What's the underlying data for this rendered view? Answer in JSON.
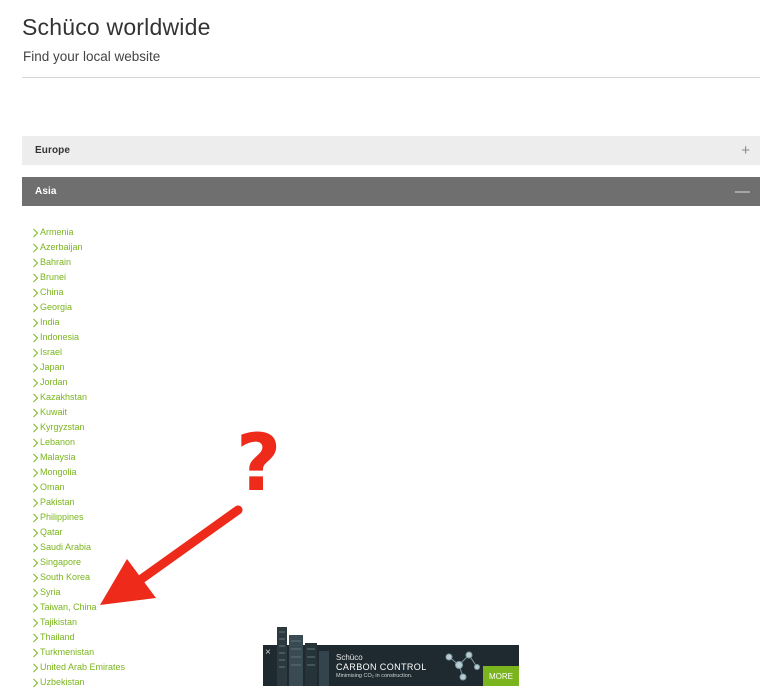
{
  "header": {
    "title": "Schüco worldwide",
    "subtitle": "Find your local website"
  },
  "accordion": {
    "europe": {
      "label": "Europe",
      "toggle": "+"
    },
    "asia": {
      "label": "Asia",
      "toggle": "—"
    }
  },
  "countries": [
    "Armenia",
    "Azerbaijan",
    "Bahrain",
    "Brunei",
    "China",
    "Georgia",
    "India",
    "Indonesia",
    "Israel",
    "Japan",
    "Jordan",
    "Kazakhstan",
    "Kuwait",
    "Kyrgyzstan",
    "Lebanon",
    "Malaysia",
    "Mongolia",
    "Oman",
    "Pakistan",
    "Philippines",
    "Qatar",
    "Saudi Arabia",
    "Singapore",
    "South Korea",
    "Syria",
    "Taiwan, China",
    "Tajikistan",
    "Thailand",
    "Turkmenistan",
    "United Arab Emirates",
    "Uzbekistan"
  ],
  "annotation": {
    "mark": "?"
  },
  "ad": {
    "close": "×",
    "brand": "Schüco",
    "title": "CARBON CONTROL",
    "tagline": "Minimising CO₂ in construction.",
    "more": "MORE"
  },
  "colors": {
    "link_green": "#7ab51d",
    "annotation_red": "#ee2a1b",
    "header_active": "#6f6f6f",
    "header_inactive": "#ededed"
  }
}
